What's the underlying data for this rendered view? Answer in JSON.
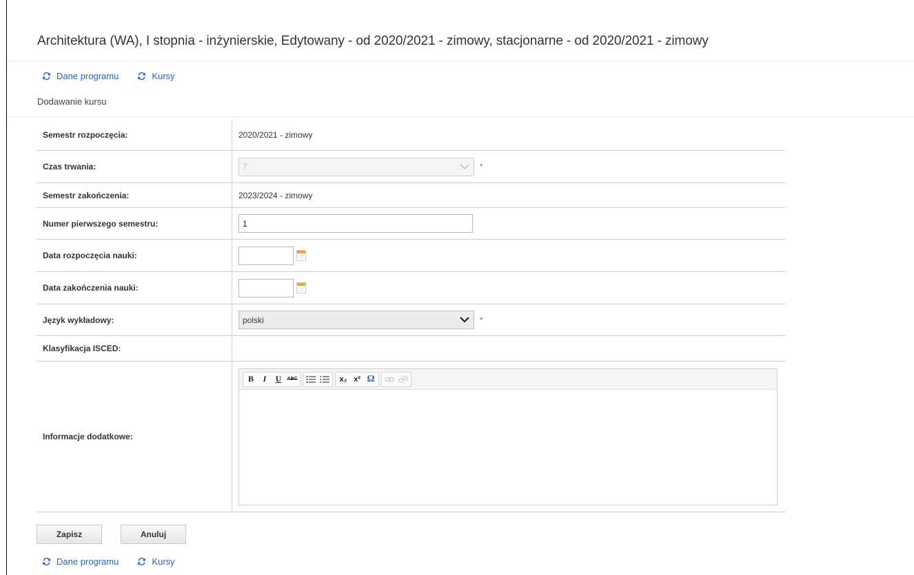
{
  "header": {
    "title": "Architektura (WA), I stopnia - inżynierskie, Edytowany - od 2020/2021 - zimowy, stacjonarne - od 2020/2021 - zimowy"
  },
  "nav": {
    "dane_programu": "Dane programu",
    "kursy": "Kursy"
  },
  "subtitle": "Dodawanie kursu",
  "form": {
    "semestr_rozpoczecia": {
      "label": "Semestr rozpoczęcia:",
      "value": "2020/2021 - zimowy"
    },
    "czas_trwania": {
      "label": "Czas trwania:",
      "value": "7",
      "required": "*"
    },
    "semestr_zakonczenia": {
      "label": "Semestr zakończenia:",
      "value": "2023/2024 - zimowy"
    },
    "numer_pierwszego": {
      "label": "Numer pierwszego semestru:",
      "value": "1"
    },
    "data_rozpoczecia": {
      "label": "Data rozpoczęcia nauki:",
      "value": ""
    },
    "data_zakonczenia": {
      "label": "Data zakończenia nauki:",
      "value": ""
    },
    "jezyk": {
      "label": "Język wykładowy:",
      "value": "polski",
      "required": "*"
    },
    "isced": {
      "label": "Klasyfikacja ISCED:"
    },
    "informacje": {
      "label": "Informacje dodatkowe:"
    }
  },
  "editor_toolbar": {
    "bold": "B",
    "italic": "I",
    "underline": "U",
    "strike": "ABC",
    "subscript": "x₂",
    "superscript": "x²",
    "special_char": "Ω"
  },
  "buttons": {
    "save": "Zapisz",
    "cancel": "Anuluj"
  },
  "colors": {
    "link": "#2a61b3",
    "required": "#c0392b",
    "calendar_accent": "#f0a830"
  }
}
